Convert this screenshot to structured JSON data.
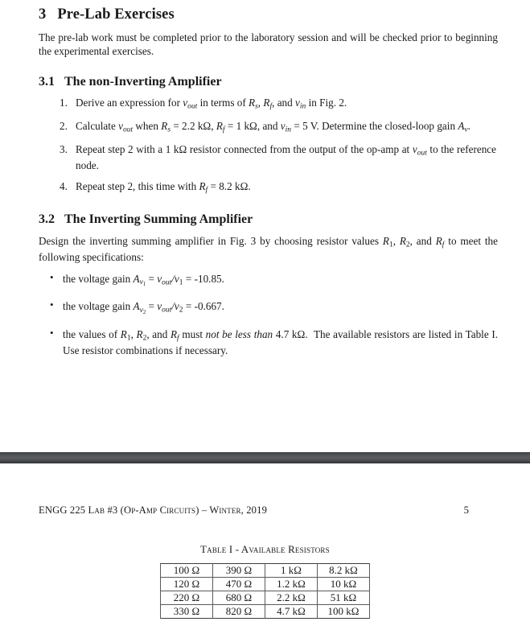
{
  "document": {
    "section": {
      "number": "3",
      "title": "Pre-Lab Exercises",
      "intro": "The pre-lab work must be completed prior to the laboratory session and will be checked prior to beginning the experimental exercises."
    },
    "subsections": [
      {
        "number": "3.1",
        "title": "The non-Inverting Amplifier",
        "items": [
          "Derive an expression for vout in terms of Rs, Rf, and vin in Fig. 2.",
          "Calculate vout when Rs = 2.2 kΩ, Rf = 1 kΩ, and vin = 5 V. Determine the closed-loop gain Av.",
          "Repeat step 2 with a 1 kΩ resistor connected from the output of the op-amp at vout to the reference node.",
          "Repeat step 2, this time with Rf = 8.2 kΩ."
        ]
      },
      {
        "number": "3.2",
        "title": "The Inverting Summing Amplifier",
        "intro": "Design the inverting summing amplifier in Fig. 3 by choosing resistor values R1, R2, and Rf to meet the following specifications:",
        "specs": [
          "the voltage gain Av1 = vout/v1 = -10.85.",
          "the voltage gain Av2 = vout/v2 = -0.667.",
          "the values of R1, R2, and Rf must not be less than 4.7 kΩ. The available resistors are listed in Table I. Use resistor combinations if necessary."
        ]
      }
    ],
    "item1": {
      "lead": "Derive an expression for",
      "v_out": "v",
      "sub_out": "out",
      "mid": "in terms of",
      "R": "R",
      "sub_s": "s",
      "sub_f": "f",
      "and": "and",
      "v_in": "v",
      "sub_in": "in",
      "tail": "in Fig. 2."
    },
    "item2": {
      "lead": "Calculate",
      "when": "when",
      "rs_val": "= 2.2 kΩ,",
      "rf_val": "= 1 kΩ, and",
      "vin_val": "= 5 V. Determine the closed-loop gain",
      "Av": "A",
      "sub_v": "v",
      "period": "."
    },
    "item3": {
      "lead": "Repeat step 2 with a 1 kΩ resistor connected from the output of the op-amp at",
      "tail": "to the reference node."
    },
    "item4": {
      "lead": "Repeat step 2, this time with",
      "val": "= 8.2 kΩ."
    },
    "spec1": {
      "lead": "the voltage gain",
      "A": "A",
      "sub_v1": "v1",
      "eq1": "=",
      "frac": "v",
      "sub_out": "out",
      "slash": "/v",
      "sub_1": "1",
      "eq2": "=",
      "value": "-10.85."
    },
    "spec2": {
      "lead": "the voltage gain",
      "sub_v2": "v2",
      "sub_2": "2",
      "value": "-0.667."
    },
    "spec3": {
      "lead": "the values of",
      "r1": "R",
      "sub_1": "1",
      "comma1": ",",
      "r2": "R",
      "sub_2": "2",
      "and": ", and",
      "rf": "R",
      "sub_f": "f",
      "must": "must",
      "emph": "not be less than",
      "value": "4.7 kΩ.",
      "tail": "The available resistors are listed in Table I. Use resistor combinations if necessary."
    },
    "footer": {
      "text": "ENGG 225 Lab #3 (Op-Amp Circuits) – Winter, 2019",
      "page": "5"
    },
    "table": {
      "caption": "Table I - Available Resistors",
      "rows": [
        [
          "100 Ω",
          "390 Ω",
          "1 kΩ",
          "8.2 kΩ"
        ],
        [
          "120 Ω",
          "470 Ω",
          "1.2 kΩ",
          "10 kΩ"
        ],
        [
          "220 Ω",
          "680 Ω",
          "2.2 kΩ",
          "51 kΩ"
        ],
        [
          "330 Ω",
          "820 Ω",
          "4.7 kΩ",
          "100 kΩ"
        ]
      ]
    }
  },
  "colors": {
    "text": "#1a1a1a",
    "separator": "#4c4f52",
    "page_background": "#ffffff",
    "table_border": "#5a5a5a"
  }
}
